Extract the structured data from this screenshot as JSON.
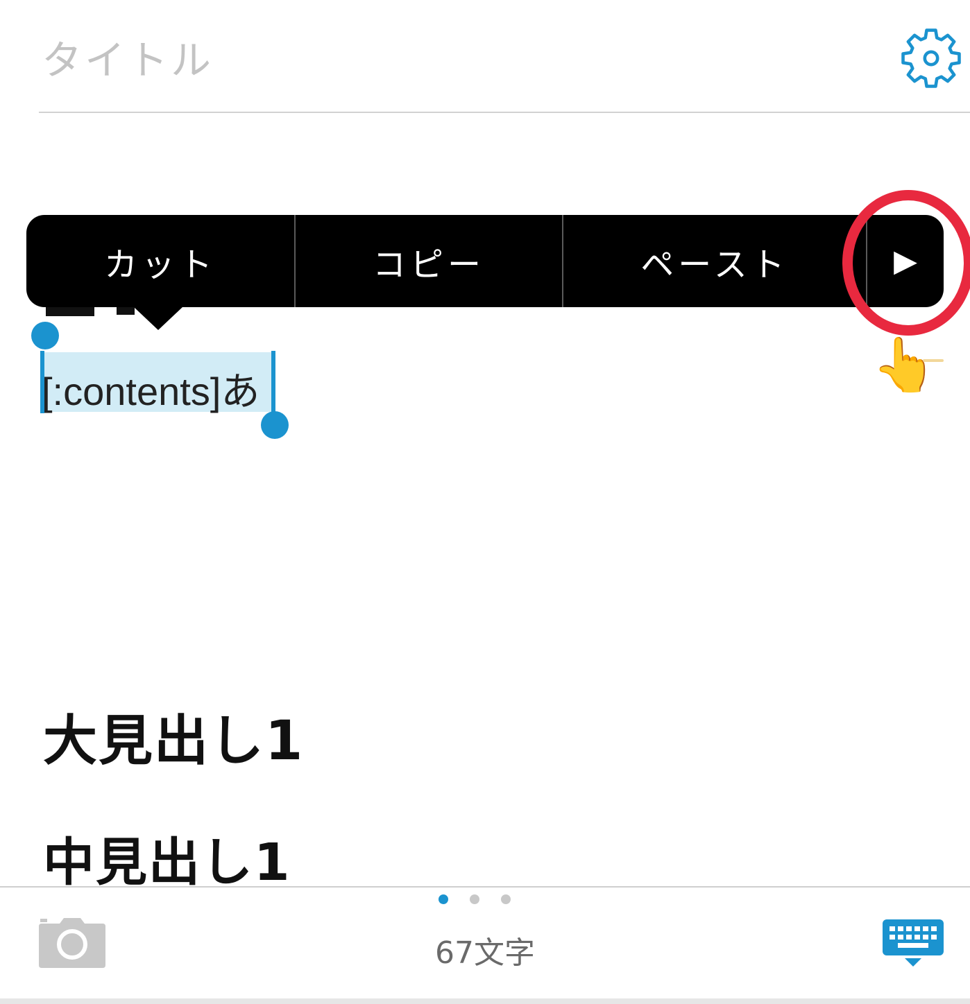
{
  "header": {
    "title_placeholder": "タイトル",
    "settings_icon": "gear-icon"
  },
  "edit_menu": {
    "items": [
      {
        "label": "カット"
      },
      {
        "label": "コピー"
      },
      {
        "label": "ペースト"
      }
    ],
    "more_icon": "play-triangle-icon",
    "more_glyph": "▶"
  },
  "editor": {
    "selected_text": "[:contents]あ",
    "heading_large": "大見出し1",
    "heading_medium": "中見出し1"
  },
  "footer": {
    "char_count": "67文字",
    "page_dots": {
      "count": 3,
      "active_index": 0
    },
    "camera_icon": "camera-icon",
    "keyboard_icon": "keyboard-dismiss-icon"
  },
  "colors": {
    "accent_blue": "#1b93cf",
    "selection_bg": "#d2ecf6",
    "highlight_ring": "#e8293f",
    "menu_bg": "#000000",
    "placeholder_gray": "#c3c3c3"
  },
  "annotation": {
    "pointer_icon": "pointing-hand-icon",
    "pointer_glyph": "👆"
  }
}
